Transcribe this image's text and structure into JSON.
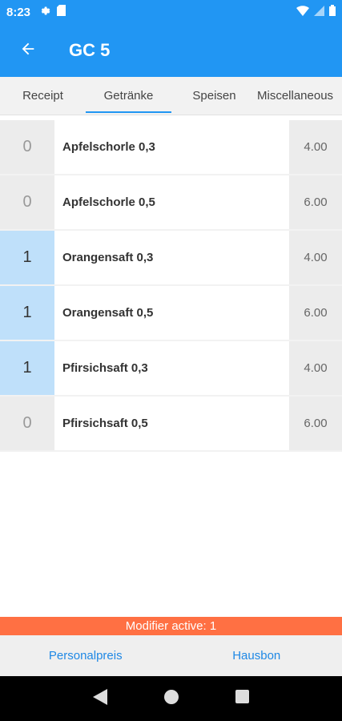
{
  "status_bar": {
    "time": "8:23",
    "icons": [
      "settings-icon",
      "sd-card-icon",
      "wifi-icon",
      "signal-icon",
      "battery-icon"
    ]
  },
  "app_bar": {
    "title": "GC 5",
    "back_icon": "arrow-back-icon"
  },
  "tabs": [
    {
      "label": "Receipt",
      "active": false
    },
    {
      "label": "Getränke",
      "active": true
    },
    {
      "label": "Speisen",
      "active": false
    },
    {
      "label": "Miscellaneous",
      "active": false
    }
  ],
  "products": [
    {
      "qty": "0",
      "name": "Apfelschorle 0,3",
      "price": "4.00",
      "selected": false
    },
    {
      "qty": "0",
      "name": "Apfelschorle 0,5",
      "price": "6.00",
      "selected": false
    },
    {
      "qty": "1",
      "name": "Orangensaft 0,3",
      "price": "4.00",
      "selected": true
    },
    {
      "qty": "1",
      "name": "Orangensaft 0,5",
      "price": "6.00",
      "selected": true
    },
    {
      "qty": "1",
      "name": "Pfirsichsaft 0,3",
      "price": "4.00",
      "selected": true
    },
    {
      "qty": "0",
      "name": "Pfirsichsaft 0,5",
      "price": "6.00",
      "selected": false
    }
  ],
  "modifier": {
    "text": "Modifier active: 1"
  },
  "bottom_actions": {
    "left": "Personalpreis",
    "right": "Hausbon"
  },
  "nav_bar": {
    "icons": [
      "back-triangle-icon",
      "home-circle-icon",
      "recents-square-icon"
    ]
  },
  "colors": {
    "primary": "#2196f3",
    "selected_qty": "#bfe0fa",
    "modifier_bar": "#ff7043",
    "action_text": "#1e88e5"
  }
}
